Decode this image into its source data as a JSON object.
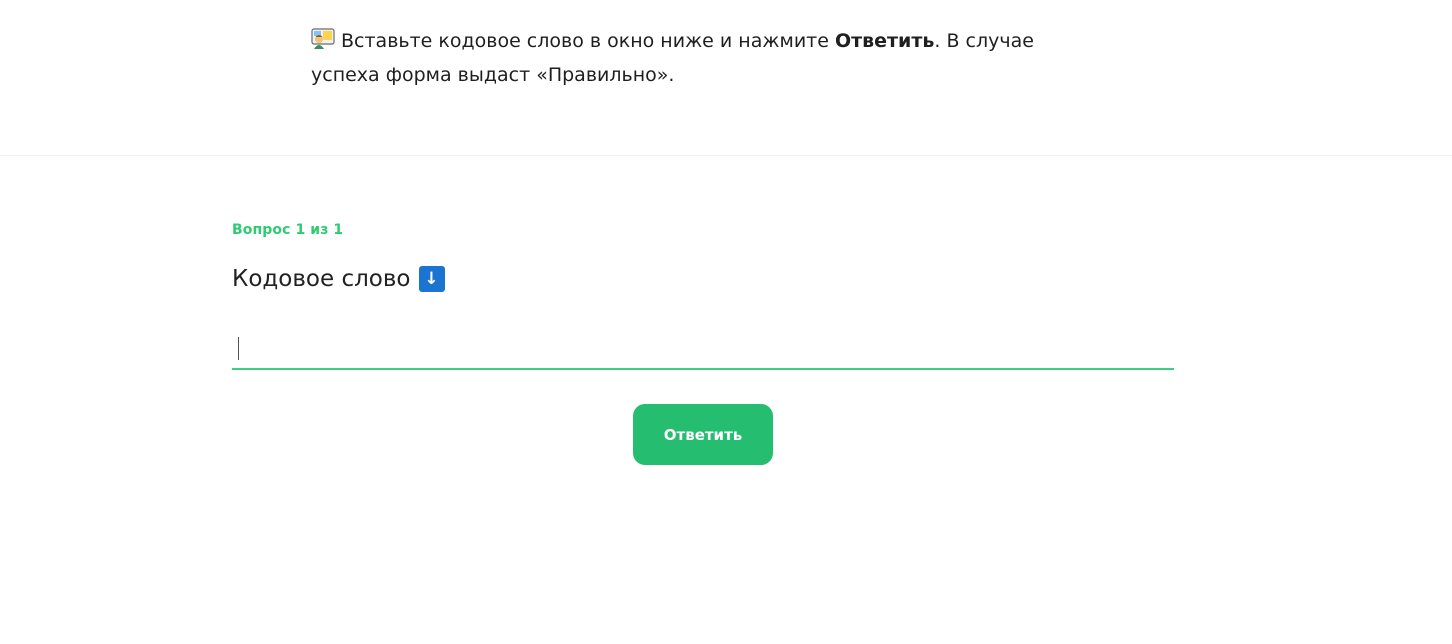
{
  "instruction": {
    "icon": "person-at-whiteboard-icon",
    "text_before": "Вставьте кодовое слово в окно ниже и нажмите ",
    "text_bold": "Ответить",
    "text_after": ". В случае успеха форма выдаст «Правильно»."
  },
  "question": {
    "counter": "Вопрос 1 из 1",
    "title": "Кодовое слово",
    "title_icon": "down-arrow-button-icon",
    "title_icon_glyph": "↓"
  },
  "answer_input": {
    "value": "",
    "placeholder": ""
  },
  "submit": {
    "label": "Ответить"
  },
  "colors": {
    "accent": "#2ecc71",
    "button": "#25bd6f",
    "input_underline": "#3ed07f",
    "arrow_box": "#1b74d1"
  }
}
